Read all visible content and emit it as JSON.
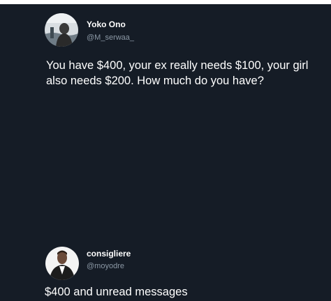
{
  "colors": {
    "background": "#151c26",
    "text": "#ffffff",
    "handle": "#8b98a5"
  },
  "tweets": [
    {
      "name": "Yoko Ono",
      "handle": "@M_serwaa_",
      "text": "You have $400, your ex really needs $100, your girl also needs $200. How much do you have?",
      "avatar_icon": "profile-photo-icon"
    },
    {
      "name": "consigliere",
      "handle": "@moyodre",
      "text": "$400 and unread messages",
      "avatar_icon": "profile-photo-icon"
    }
  ]
}
